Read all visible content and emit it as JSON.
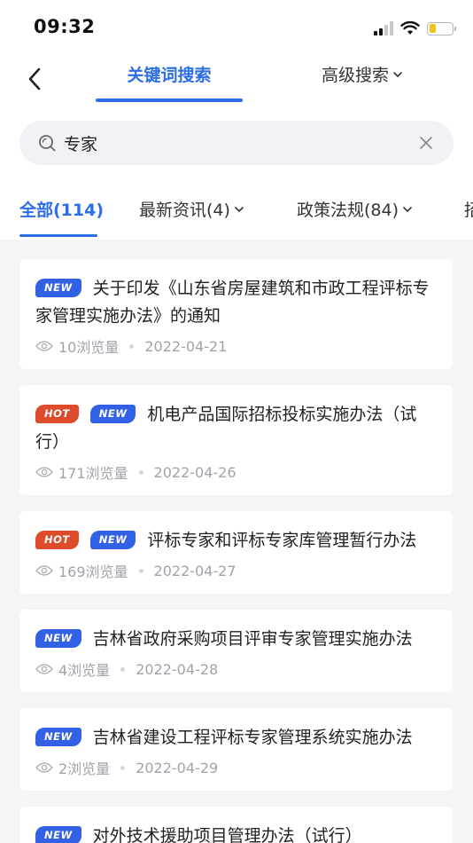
{
  "status_bar": {
    "time": "09:32"
  },
  "nav": {
    "tab_keyword": "关键词搜索",
    "tab_advanced": "高级搜索"
  },
  "search": {
    "value": "专家",
    "placeholder": ""
  },
  "categories": [
    {
      "label": "全部(114)"
    },
    {
      "label": "最新资讯(4)"
    },
    {
      "label": "政策法规(84)"
    },
    {
      "label": "招"
    }
  ],
  "items": [
    {
      "badges": [
        "NEW"
      ],
      "title": "关于印发《山东省房屋建筑和市政工程评标专家管理实施办法》的通知",
      "views": "10浏览量",
      "date": "2022-04-21"
    },
    {
      "badges": [
        "HOT",
        "NEW"
      ],
      "title": "机电产品国际招标投标实施办法（试行）",
      "views": "171浏览量",
      "date": "2022-04-26"
    },
    {
      "badges": [
        "HOT",
        "NEW"
      ],
      "title": "评标专家和评标专家库管理暂行办法",
      "views": "169浏览量",
      "date": "2022-04-27"
    },
    {
      "badges": [
        "NEW"
      ],
      "title": "吉林省政府采购项目评审专家管理实施办法",
      "views": "4浏览量",
      "date": "2022-04-28"
    },
    {
      "badges": [
        "NEW"
      ],
      "title": "吉林省建设工程评标专家管理系统实施办法",
      "views": "2浏览量",
      "date": "2022-04-29"
    },
    {
      "badges": [
        "NEW"
      ],
      "title": "对外技术援助项目管理办法（试行）",
      "views": "",
      "date": ""
    }
  ],
  "colors": {
    "accent": "#2b6ee8",
    "hot": "#de4b2a",
    "new": "#3361e6"
  }
}
